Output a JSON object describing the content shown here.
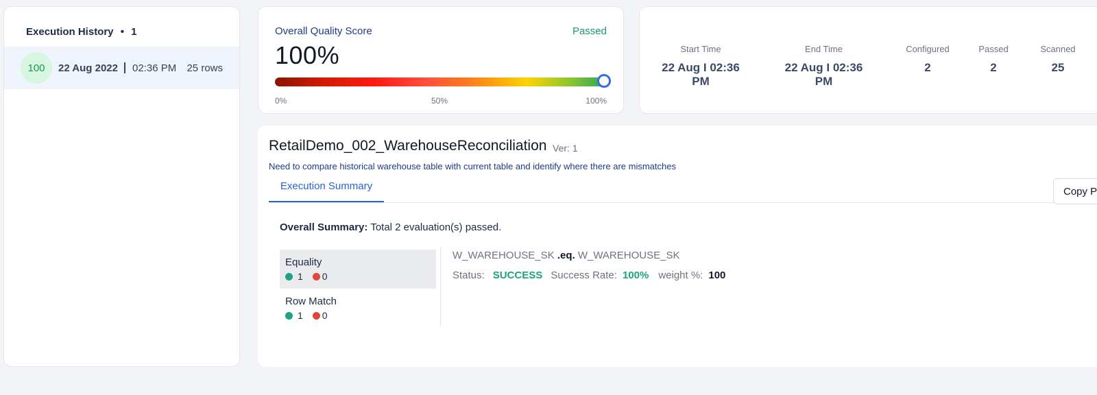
{
  "history": {
    "title": "Execution History",
    "dot": "•",
    "count": "1",
    "items": [
      {
        "score": "100",
        "date": "22 Aug 2022",
        "time": "02:36 PM",
        "rows": "25 rows"
      }
    ]
  },
  "quality": {
    "label": "Overall Quality Score",
    "status": "Passed",
    "score": "100%",
    "progress_percent": 100,
    "ticks": [
      "0%",
      "50%",
      "100%"
    ]
  },
  "stats": [
    {
      "label": "Start Time",
      "value": "22 Aug I 02:36 PM"
    },
    {
      "label": "End Time",
      "value": "22 Aug I 02:36 PM"
    },
    {
      "label": "Configured",
      "value": "2"
    },
    {
      "label": "Passed",
      "value": "2"
    },
    {
      "label": "Scanned",
      "value": "25"
    }
  ],
  "main": {
    "title": "RetailDemo_002_WarehouseReconciliation",
    "version": "Ver: 1",
    "description": "Need to compare historical warehouse table with current table and identify where there are mismatches",
    "tab_label": "Execution Summary",
    "copy_button": "Copy Pe",
    "summary_label": "Overall Summary:",
    "summary_text": "Total 2 evaluation(s) passed.",
    "rules": [
      {
        "name": "Equality",
        "passed": "1",
        "failed": "0"
      },
      {
        "name": "Row Match",
        "passed": "1",
        "failed": "0"
      }
    ],
    "detail": {
      "left_field": "W_WAREHOUSE_SK",
      "operator": ".eq.",
      "right_field": "W_WAREHOUSE_SK",
      "status_label": "Status:",
      "status_value": "SUCCESS",
      "rate_label": "Success Rate:",
      "rate_value": "100%",
      "weight_label": "weight %:",
      "weight_value": "100"
    }
  },
  "colors": {
    "accent": "#2a62d6",
    "success": "#1aa37e",
    "fail": "#e0463c"
  }
}
